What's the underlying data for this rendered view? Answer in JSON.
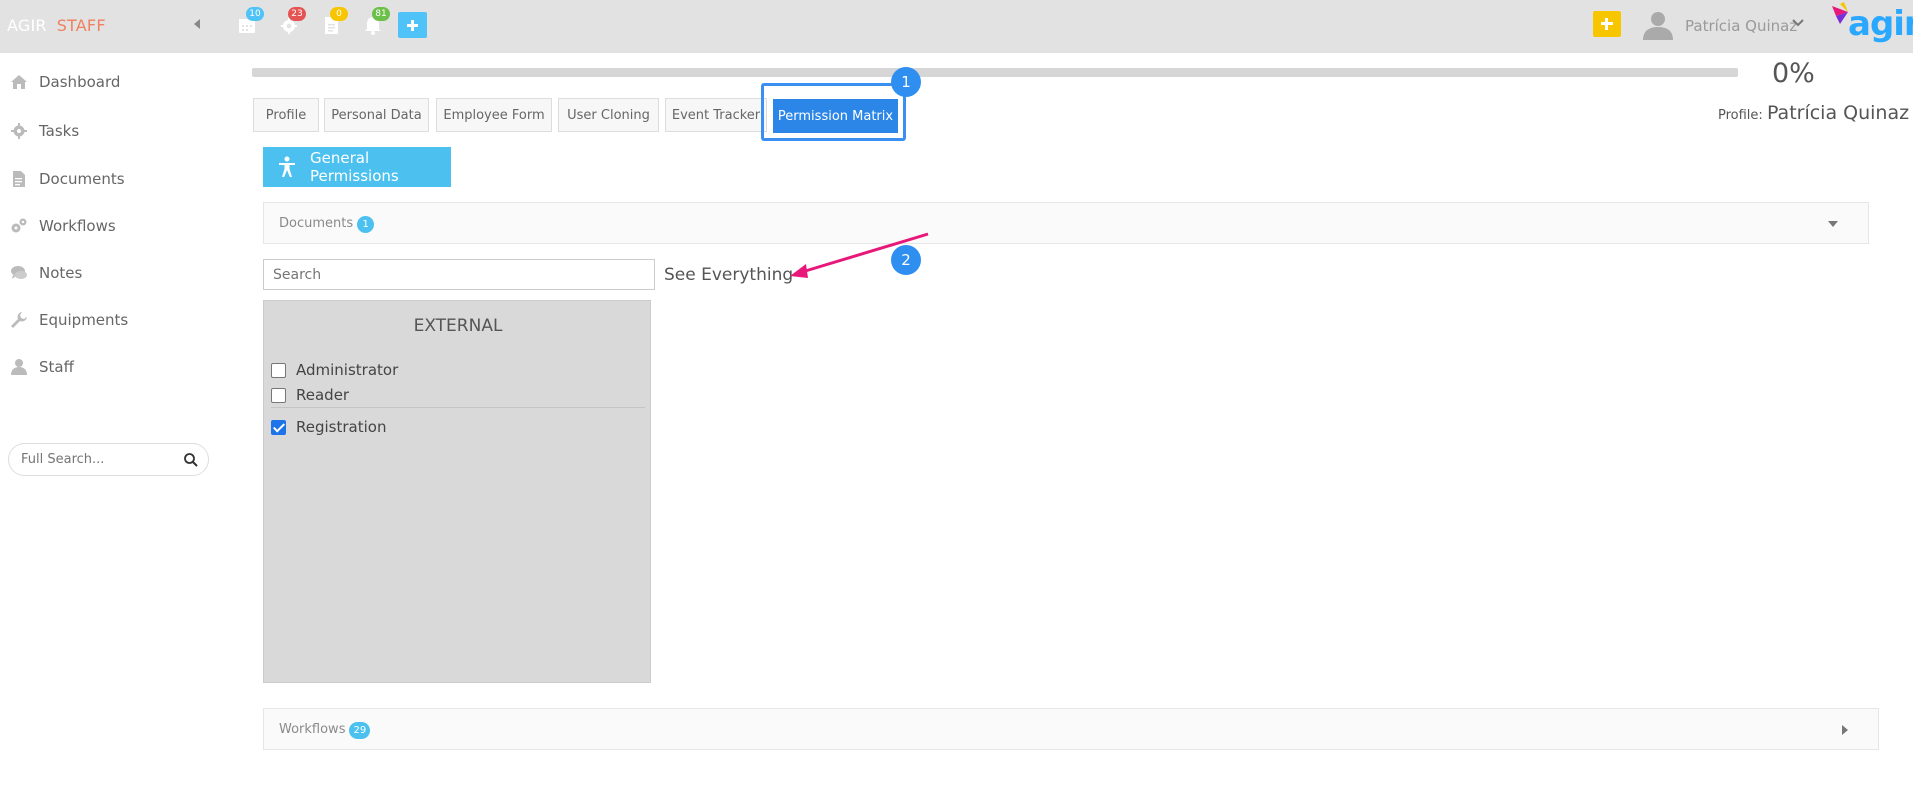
{
  "topbar": {
    "brand_part1": "AGIR",
    "brand_part2": "STAFF",
    "badges": [
      {
        "name": "calendar-icon",
        "count": "10",
        "color": "#4fc3f7"
      },
      {
        "name": "gear-icon",
        "count": "23",
        "color": "#e55353"
      },
      {
        "name": "document-icon",
        "count": "0",
        "color": "#f7c600"
      },
      {
        "name": "bell-icon",
        "count": "81",
        "color": "#6cc04a"
      }
    ],
    "user_name": "Patrícia Quinaz",
    "logo_text": "agir"
  },
  "sidebar": {
    "items": [
      {
        "label": "Dashboard",
        "icon": "home-icon"
      },
      {
        "label": "Tasks",
        "icon": "gear-icon"
      },
      {
        "label": "Documents",
        "icon": "document-icon"
      },
      {
        "label": "Workflows",
        "icon": "gears-icon"
      },
      {
        "label": "Notes",
        "icon": "chat-icon"
      },
      {
        "label": "Equipments",
        "icon": "wrench-icon"
      },
      {
        "label": "Staff",
        "icon": "user-icon"
      }
    ],
    "search_placeholder": "Full Search..."
  },
  "main": {
    "progress_percent": 0,
    "progress_label": "0%",
    "tabs": [
      {
        "label": "Profile"
      },
      {
        "label": "Personal Data"
      },
      {
        "label": "Employee Form"
      },
      {
        "label": "User Cloning"
      },
      {
        "label": "Event Tracker"
      },
      {
        "label": "Permission Matrix",
        "active": true
      }
    ],
    "profile_prefix": "Profile:",
    "profile_name": "Patrícia Quinaz",
    "general_permissions_label": "General Permissions",
    "documents_panel": {
      "title": "Documents",
      "count": "1"
    },
    "search_placeholder": "Search",
    "see_everything": "See Everything",
    "external": {
      "title": "EXTERNAL",
      "options": [
        {
          "label": "Administrator",
          "checked": false
        },
        {
          "label": "Reader",
          "checked": false
        },
        {
          "label": "Registration",
          "checked": true
        }
      ]
    },
    "workflows_panel": {
      "title": "Workflows",
      "count": "29"
    }
  },
  "annotations": {
    "step1": "1",
    "step2": "2",
    "highlight_color": "#3a8ff0",
    "arrow_color": "#e8187a"
  }
}
